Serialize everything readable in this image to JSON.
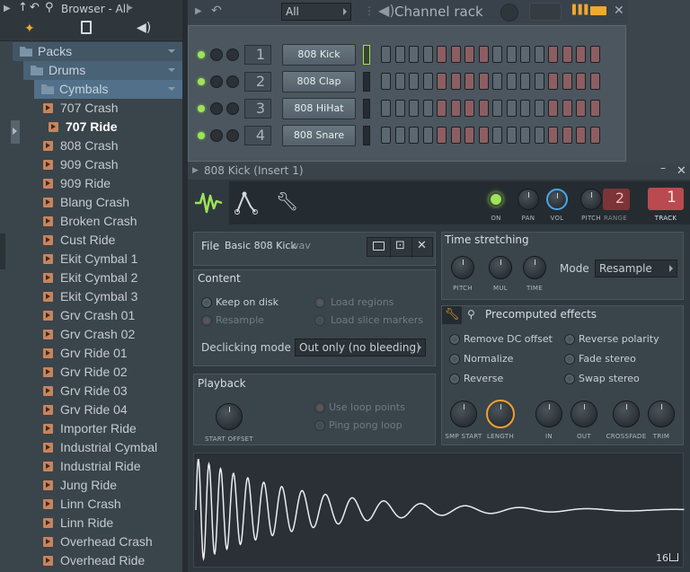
{
  "browser": {
    "title": "Browser - All",
    "items": [
      {
        "label": "Packs",
        "kind": "folder",
        "level": 0
      },
      {
        "label": "Drums",
        "kind": "folder",
        "level": 1
      },
      {
        "label": "Cymbals",
        "kind": "folder",
        "level": 2
      },
      {
        "label": "707 Crash",
        "kind": "file",
        "level": 3
      },
      {
        "label": "707 Ride",
        "kind": "file",
        "level": 3,
        "selected": true
      },
      {
        "label": "808 Crash",
        "kind": "file",
        "level": 3
      },
      {
        "label": "909 Crash",
        "kind": "file",
        "level": 3
      },
      {
        "label": "909 Ride",
        "kind": "file",
        "level": 3
      },
      {
        "label": "Blang Crash",
        "kind": "file",
        "level": 3
      },
      {
        "label": "Broken Crash",
        "kind": "file",
        "level": 3
      },
      {
        "label": "Cust Ride",
        "kind": "file",
        "level": 3
      },
      {
        "label": "Ekit Cymbal 1",
        "kind": "file",
        "level": 3
      },
      {
        "label": "Ekit Cymbal 2",
        "kind": "file",
        "level": 3
      },
      {
        "label": "Ekit Cymbal 3",
        "kind": "file",
        "level": 3
      },
      {
        "label": "Grv Crash 01",
        "kind": "file",
        "level": 3
      },
      {
        "label": "Grv Crash 02",
        "kind": "file",
        "level": 3
      },
      {
        "label": "Grv Ride 01",
        "kind": "file",
        "level": 3
      },
      {
        "label": "Grv Ride 02",
        "kind": "file",
        "level": 3
      },
      {
        "label": "Grv Ride 03",
        "kind": "file",
        "level": 3
      },
      {
        "label": "Grv Ride 04",
        "kind": "file",
        "level": 3
      },
      {
        "label": "Importer Ride",
        "kind": "file",
        "level": 3
      },
      {
        "label": "Industrial Cymbal",
        "kind": "file",
        "level": 3
      },
      {
        "label": "Industrial Ride",
        "kind": "file",
        "level": 3
      },
      {
        "label": "Jung Ride",
        "kind": "file",
        "level": 3
      },
      {
        "label": "Linn Crash",
        "kind": "file",
        "level": 3
      },
      {
        "label": "Linn Ride",
        "kind": "file",
        "level": 3
      },
      {
        "label": "Overhead Crash",
        "kind": "file",
        "level": 3
      },
      {
        "label": "Overhead Ride",
        "kind": "file",
        "level": 3
      }
    ]
  },
  "rack": {
    "filter": "All",
    "title": "Channel rack",
    "channels": [
      {
        "num": "1",
        "name": "808 Kick"
      },
      {
        "num": "2",
        "name": "808 Clap"
      },
      {
        "num": "3",
        "name": "808 HiHat"
      },
      {
        "num": "4",
        "name": "808 Snare"
      }
    ]
  },
  "plugin": {
    "title": "808 Kick (Insert 1)",
    "header": {
      "on": "ON",
      "pan": "PAN",
      "vol": "VOL",
      "pitch": "PITCH",
      "range": "RANGE",
      "range_value": "2",
      "track": "TRACK",
      "track_value": "1"
    },
    "file_label": "File",
    "file_name": "Basic 808 Kick",
    "file_ext": ".wav",
    "content": {
      "title": "Content",
      "keep": "Keep on disk",
      "load_regions": "Load regions",
      "resample": "Resample",
      "load_slice": "Load slice markers",
      "declick_label": "Declicking mode",
      "declick_value": "Out only (no bleeding)"
    },
    "playback": {
      "title": "Playback",
      "start_offset": "START OFFSET",
      "use_loop": "Use loop points",
      "ping_pong": "Ping pong loop"
    },
    "stretch": {
      "title": "Time stretching",
      "pitch": "PITCH",
      "mul": "MUL",
      "time": "TIME",
      "mode_label": "Mode",
      "mode_value": "Resample"
    },
    "effects": {
      "title": "Precomputed effects",
      "remove_dc": "Remove DC offset",
      "reverse_polarity": "Reverse polarity",
      "normalize": "Normalize",
      "fade_stereo": "Fade stereo",
      "reverse": "Reverse",
      "swap_stereo": "Swap stereo",
      "knobs": [
        "SMP START",
        "LENGTH",
        "IN",
        "OUT",
        "CROSSFADE",
        "TRIM"
      ]
    },
    "wave_label": "16"
  },
  "colors": {
    "accent_green": "#9ee35a",
    "accent_orange": "#f0a030",
    "track_red": "#b94a4f",
    "wave": "#e8eef0",
    "vol_blue": "#4aa6e6"
  }
}
